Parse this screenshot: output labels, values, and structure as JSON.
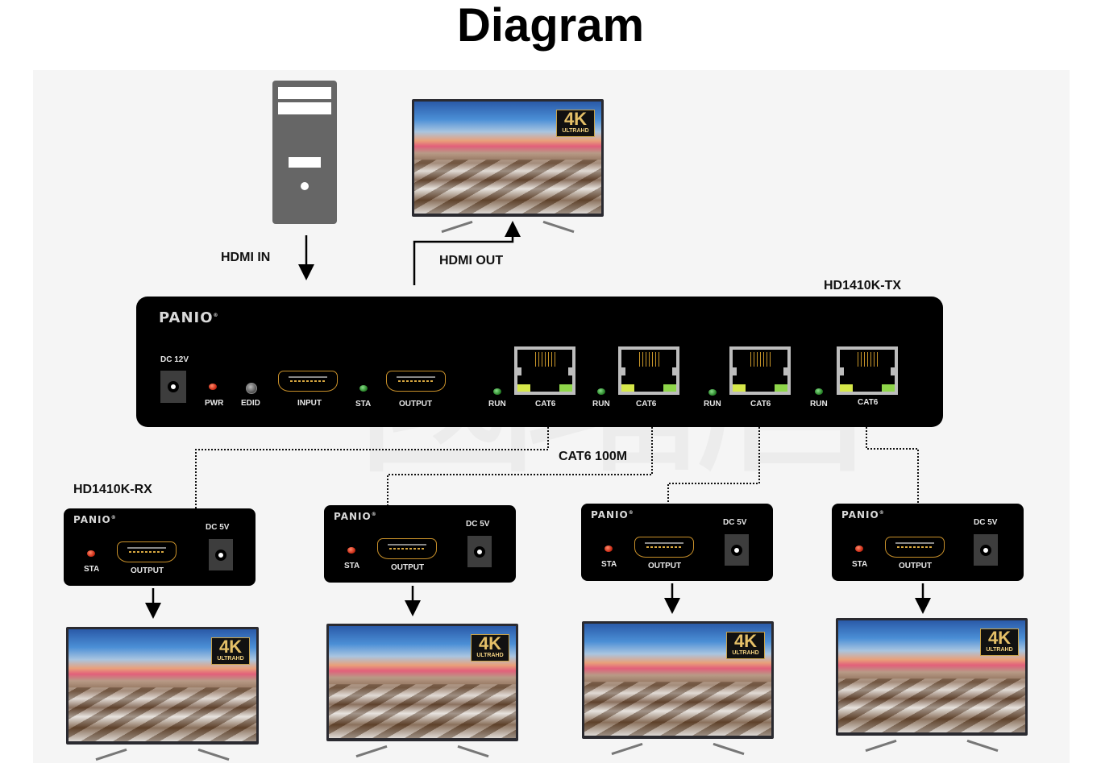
{
  "title": "Diagram",
  "watermark": "國璠唐",
  "labels": {
    "hdmi_in": "HDMI IN",
    "hdmi_out": "HDMI OUT",
    "transmitter_model": "HD1410K-TX",
    "receiver_model": "HD1410K-RX",
    "cable": "CAT6 100M"
  },
  "source": {
    "type": "pc-tower"
  },
  "tv_badge": {
    "big": "4K",
    "small": "ULTRAHD"
  },
  "transmitter": {
    "brand": "PANIO",
    "power_label": "DC 12V",
    "indicators": [
      {
        "label": "PWR",
        "color": "red"
      },
      {
        "label": "EDID",
        "color": "gray"
      }
    ],
    "input_label": "INPUT",
    "sta_label": "STA",
    "output_label": "OUTPUT",
    "ports": [
      {
        "led_label": "RUN",
        "port_label": "CAT6"
      },
      {
        "led_label": "RUN",
        "port_label": "CAT6"
      },
      {
        "led_label": "RUN",
        "port_label": "CAT6"
      },
      {
        "led_label": "RUN",
        "port_label": "CAT6"
      }
    ]
  },
  "receivers": [
    {
      "brand": "PANIO",
      "sta_label": "STA",
      "output_label": "OUTPUT",
      "power_label": "DC 5V"
    },
    {
      "brand": "PANIO",
      "sta_label": "STA",
      "output_label": "OUTPUT",
      "power_label": "DC 5V"
    },
    {
      "brand": "PANIO",
      "sta_label": "STA",
      "output_label": "OUTPUT",
      "power_label": "DC 5V"
    },
    {
      "brand": "PANIO",
      "sta_label": "STA",
      "output_label": "OUTPUT",
      "power_label": "DC 5V"
    }
  ]
}
